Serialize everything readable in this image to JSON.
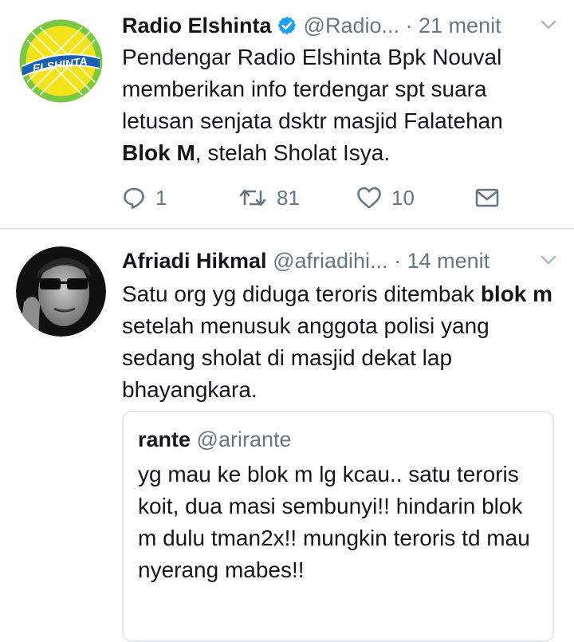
{
  "colors": {
    "text": "#14171a",
    "secondary": "#657786",
    "verified_blue": "#1da1f2",
    "divider": "#e6ecf0"
  },
  "tweets": [
    {
      "name": "Radio Elshinta",
      "verified": true,
      "handle": "@Radio...",
      "separator": "·",
      "time": "21 menit",
      "avatar_logo_text": "ELSHINTA",
      "text_parts": {
        "p1": "Pendengar Radio Elshinta Bpk Nouval memberikan info terdengar spt suara letusan senjata dsktr masjid Falatehan ",
        "bold1": "Blok M",
        "p2": ", stelah Sholat Isya."
      },
      "actions": {
        "reply_count": "1",
        "retweet_count": "81",
        "like_count": "10"
      },
      "icons": [
        "reply-icon",
        "retweet-icon",
        "like-icon",
        "direct-message-icon"
      ]
    },
    {
      "name": "Afriadi Hikmal",
      "handle": "@afriadihi...",
      "separator": "·",
      "time": "14 menit",
      "text_parts": {
        "p1": "Satu org yg diduga teroris ditembak ",
        "bold1": "blok m",
        "p2": " setelah menusuk anggota polisi yang sedang sholat di masjid dekat lap bhayangkara."
      },
      "quote": {
        "name": "rante",
        "handle": "@arirante",
        "text": "yg mau ke blok m lg kcau.. satu teroris koit, dua masi sembunyi!! hindarin blok m dulu tman2x!! mungkin teroris td mau nyerang mabes!!"
      }
    }
  ]
}
